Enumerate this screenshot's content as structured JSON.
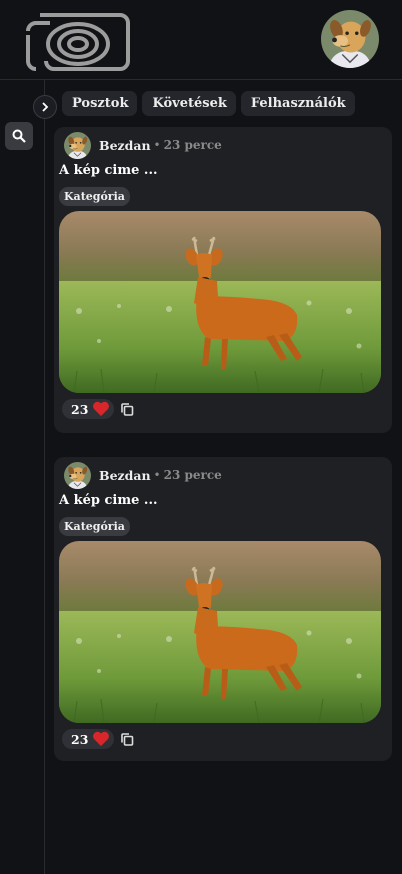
{
  "tabs": [
    {
      "label": "Posztok"
    },
    {
      "label": "Követések"
    },
    {
      "label": "Felhasználók"
    }
  ],
  "posts": [
    {
      "author": "Bezdan",
      "time": "23 perce",
      "title": "A kép cime ...",
      "category": "Kategória",
      "likes": "23"
    },
    {
      "author": "Bezdan",
      "time": "23 perce",
      "title": "A kép cime ...",
      "category": "Kategória",
      "likes": "23"
    }
  ],
  "separator": "•",
  "colors": {
    "background": "#111216",
    "card": "#1f2024",
    "heart": "#d9262a"
  },
  "icons": {
    "logo": "camera-logo-icon",
    "expand": "chevron-right-icon",
    "search": "search-icon",
    "like": "heart-icon",
    "copy": "copy-icon"
  }
}
